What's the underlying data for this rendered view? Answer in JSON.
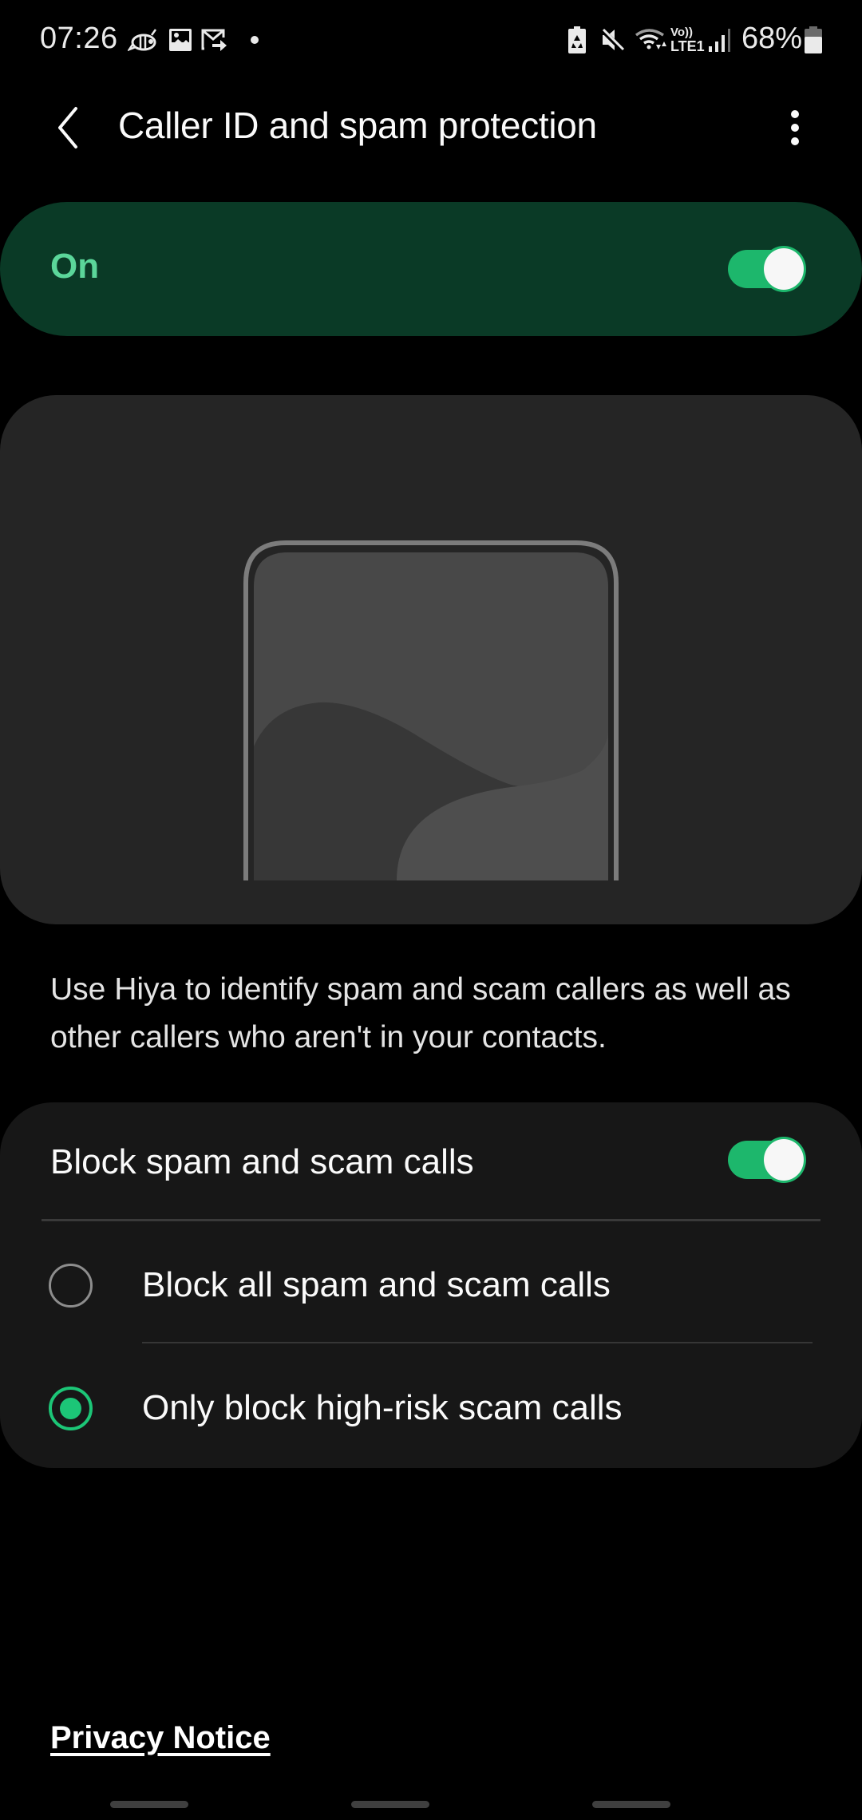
{
  "status_bar": {
    "time": "07:26",
    "left_icons": [
      "bee-app-icon",
      "gallery-icon",
      "mail-forward-icon",
      "notification-dot-icon"
    ],
    "right_icons": [
      "battery-saver-icon",
      "mute-icon",
      "wifi-data-icon",
      "volte-lte-icon",
      "signal-icon"
    ],
    "volte_label": "Vo))",
    "lte_label": "LTE1",
    "battery_percent": "68%",
    "battery_level": 0.68
  },
  "app_bar": {
    "title": "Caller ID and spam protection",
    "back_icon": "back-chevron-icon",
    "more_icon": "more-vertical-icon"
  },
  "master_switch": {
    "label": "On",
    "enabled": true
  },
  "illustration": {
    "description": "phone-outline-illustration"
  },
  "description": "Use Hiya to identify spam and scam callers as well as other callers who aren't in your contacts.",
  "block_settings": {
    "toggle_label": "Block spam and scam calls",
    "toggle_enabled": true,
    "options": [
      {
        "label": "Block all spam and scam calls",
        "selected": false
      },
      {
        "label": "Only block high-risk scam calls",
        "selected": true
      }
    ]
  },
  "footer": {
    "privacy_link": "Privacy Notice"
  },
  "colors": {
    "accent_green": "#1db76c",
    "master_switch_bg": "#0a3a26",
    "master_label": "#5bd69a",
    "card_bg": "#171717"
  }
}
